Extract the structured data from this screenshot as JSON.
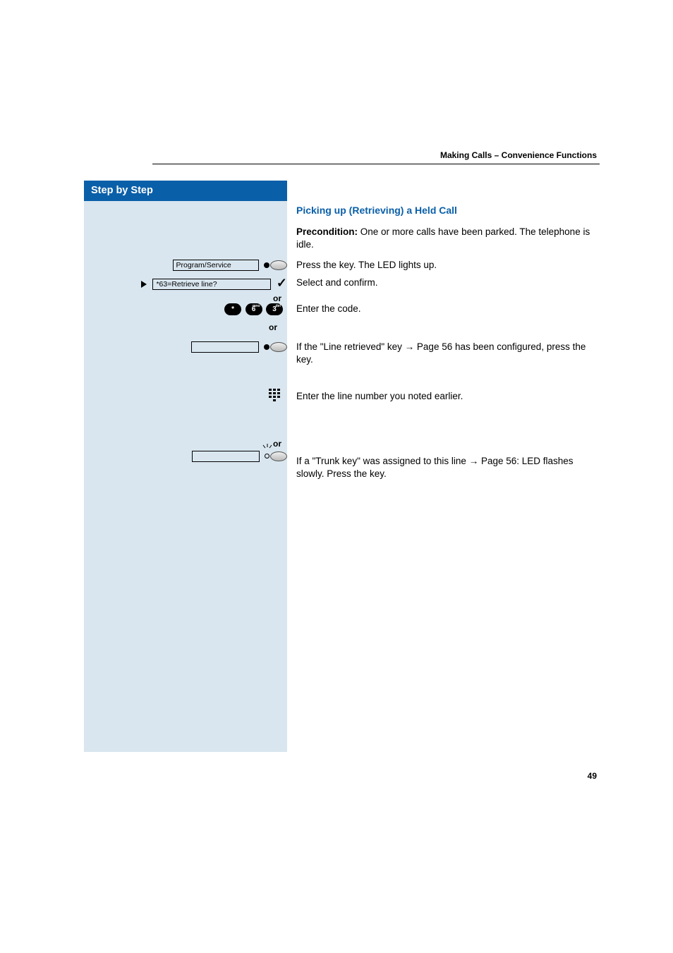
{
  "header": {
    "section": "Making Calls – Convenience Functions"
  },
  "sidebar": {
    "title": "Step by Step"
  },
  "section_title": "Picking up (Retrieving) a Held Call",
  "precondition": {
    "label": "Precondition:",
    "text": " One or more calls have been parked. The telephone is idle."
  },
  "steps": {
    "program_service": {
      "label": "Program/Service",
      "text": "Press the key. The LED lights up."
    },
    "retrieve_line": {
      "label": "*63=Retrieve line?",
      "text": "Select and confirm."
    },
    "or1": "or",
    "code": {
      "keys": [
        "*",
        "6",
        "3"
      ],
      "key_sup": [
        "",
        "mno",
        "def"
      ],
      "text": "Enter the code."
    },
    "or2": "or",
    "line_retrieved": {
      "text_a": "If the \"Line retrieved\" key ",
      "arrow": "→",
      "page_ref": " Page 56 has been configured, press the key."
    },
    "enter_line": {
      "text": "Enter the line number you noted earlier."
    },
    "or3": "or",
    "trunk_key": {
      "text_a": "If a \"Trunk key\" was assigned to this line ",
      "arrow": "→",
      "page_ref": " Page 56: LED flashes slowly. Press the key."
    }
  },
  "page_number": "49"
}
